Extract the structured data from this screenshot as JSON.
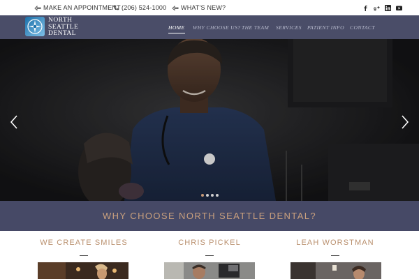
{
  "topbar": {
    "appointment_label": "MAKE AN APPOINTMENT",
    "phone_label": "(206) 524-1000",
    "whats_new_label": "WHAT'S NEW?",
    "social_icons": [
      "facebook-icon",
      "google-plus-icon",
      "linkedin-icon",
      "youtube-icon"
    ]
  },
  "header": {
    "logo_lines": [
      "NORTH",
      "SEATTLE",
      "DENTAL"
    ],
    "nav": [
      {
        "label": "HOME",
        "active": true
      },
      {
        "label": "WHY CHOOSE US?",
        "active": false
      },
      {
        "label": "THE TEAM",
        "active": false
      },
      {
        "label": "SERVICES",
        "active": false
      },
      {
        "label": "PATIENT INFO",
        "active": false
      },
      {
        "label": "CONTACT",
        "active": false
      }
    ]
  },
  "hero": {
    "slide_count": 4,
    "active_slide": 1,
    "prev_icon": "chevron-left-icon",
    "next_icon": "chevron-right-icon",
    "play_icon": "play-button-icon"
  },
  "band": {
    "title": "WHY CHOOSE NORTH SEATTLE DENTAL?"
  },
  "features": [
    {
      "title": "WE CREATE SMILES"
    },
    {
      "title": "CHRIS PICKEL"
    },
    {
      "title": "LEAH WORSTMAN"
    }
  ],
  "colors": {
    "header_bg": "#4a4d68",
    "band_bg": "#464966",
    "accent_gold": "#c9a07e",
    "nav_text": "#b9bccf"
  }
}
